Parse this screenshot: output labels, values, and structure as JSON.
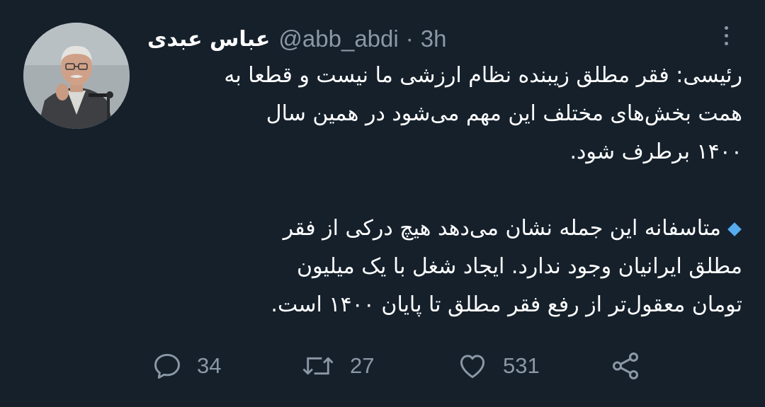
{
  "tweet": {
    "author": {
      "display_name": "عباس عبدی",
      "handle": "@abb_abdi",
      "separator": "·",
      "time": "3h",
      "avatar_icon": "profile-photo"
    },
    "body": {
      "paragraph_1": {
        "line_1": "رئیسی: فقر مطلق زیبنده نظام ارزشی ما نیست و قطعا به",
        "line_2": "همت بخش‌های مختلف این مهم می‌شود در همین سال",
        "line_3": "۱۴۰۰ برطرف شود."
      },
      "paragraph_2": {
        "bullet_icon": "blue-diamond-emoji",
        "bullet_color": "#55acee",
        "line_1": "متاسفانه این جمله نشان می‌دهد هیچ درکی از فقر",
        "line_2": "مطلق ایرانیان وجود ندارد. ایجاد شغل با یک میلیون",
        "line_3": "تومان معقول‌تر از رفع فقر مطلق تا پایان ۱۴۰۰ است."
      }
    },
    "actions": {
      "reply": {
        "icon": "reply-icon",
        "count": "34"
      },
      "retweet": {
        "icon": "retweet-icon",
        "count": "27"
      },
      "like": {
        "icon": "heart-icon",
        "count": "531"
      },
      "share": {
        "icon": "share-icon"
      }
    },
    "colors": {
      "background": "#15202b",
      "text": "#ffffff",
      "secondary": "#8b98a5"
    }
  }
}
